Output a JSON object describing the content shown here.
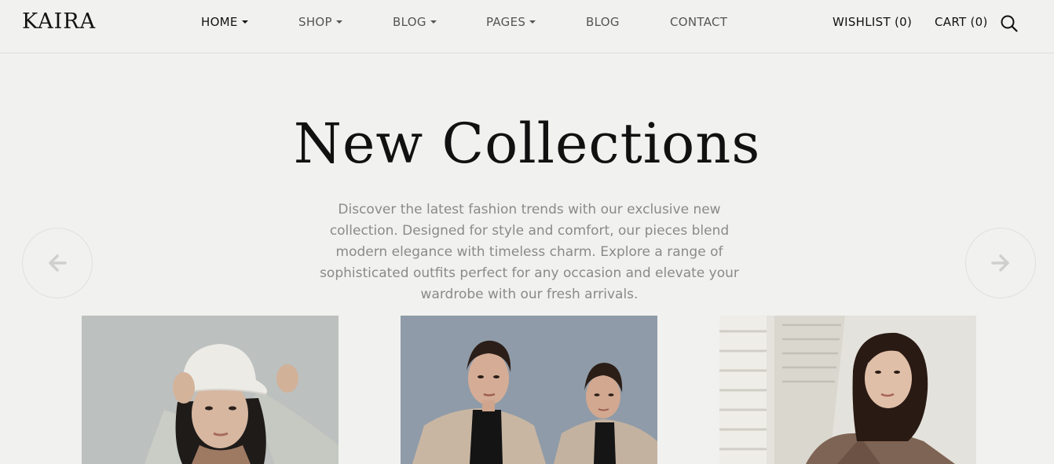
{
  "header": {
    "logo": "KAIRA",
    "nav": [
      {
        "label": "HOME",
        "dropdown": true,
        "active": true
      },
      {
        "label": "SHOP",
        "dropdown": true,
        "active": false
      },
      {
        "label": "BLOG",
        "dropdown": true,
        "active": false
      },
      {
        "label": "PAGES",
        "dropdown": true,
        "active": false
      },
      {
        "label": "BLOG",
        "dropdown": false,
        "active": false
      },
      {
        "label": "CONTACT",
        "dropdown": false,
        "active": false
      }
    ],
    "wishlist": "WISHLIST (0)",
    "cart": "CART (0)",
    "search_icon": "search-icon"
  },
  "hero": {
    "title": "New Collections",
    "description": "Discover the latest fashion trends with our exclusive new collection. Designed for style and comfort, our pieces blend modern elegance with timeless charm. Explore a range of sophisticated outfits perfect for any occasion and elevate your wardrobe with our fresh arrivals."
  },
  "carousel": {
    "prev_icon": "arrow-left-icon",
    "next_icon": "arrow-right-icon"
  },
  "products": [
    {
      "image": "woman-in-white-bucket-hat"
    },
    {
      "image": "two-models-in-beige-trench-coats"
    },
    {
      "image": "woman-in-plaid-blazer"
    }
  ],
  "colors": {
    "background": "#f1f1ef",
    "text": "#111111",
    "muted": "#8a8a8a"
  }
}
